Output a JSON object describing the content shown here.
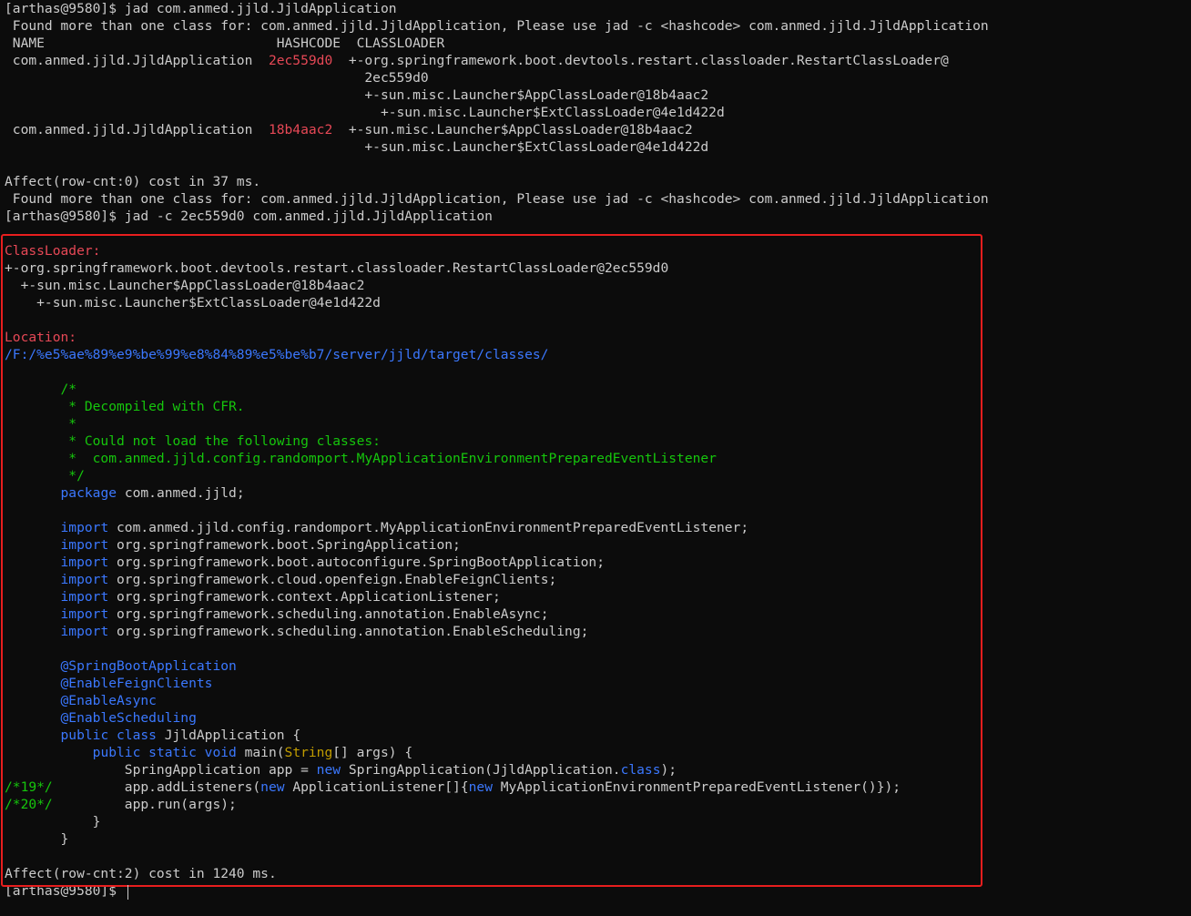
{
  "terminal": {
    "lines": [
      {
        "text": "[arthas@9580]$ jad com.anmed.jjld.JjldApplication",
        "spans": [
          {
            "t": "[arthas@9580]$ jad com.anmed.jjld.JjldApplication",
            "c": "white"
          }
        ]
      },
      {
        "text": " Found more than one class for: com.anmed.jjld.JjldApplication, Please use jad -c <hashcode> com.anmed.jjld.JjldApplication",
        "spans": [
          {
            "t": " Found more than one class for: com.anmed.jjld.JjldApplication, Please use jad -c <hashcode> com.anmed.jjld.JjldApplication",
            "c": "white"
          }
        ]
      },
      {
        "text": " NAME                             HASHCODE  CLASSLOADER",
        "spans": [
          {
            "t": " NAME                             HASHCODE  CLASSLOADER",
            "c": "white"
          }
        ]
      },
      {
        "text": " com.anmed.jjld.JjldApplication  2ec559d0  +-org.springframework.boot.devtools.restart.classloader.RestartClassLoader@",
        "spans": [
          {
            "t": " com.anmed.jjld.JjldApplication  ",
            "c": "white"
          },
          {
            "t": "2ec559d0",
            "c": "red"
          },
          {
            "t": "  +-org.springframework.boot.devtools.restart.classloader.RestartClassLoader@",
            "c": "white"
          }
        ]
      },
      {
        "text": "                                             2ec559d0",
        "spans": [
          {
            "t": "                                             2ec559d0",
            "c": "white"
          }
        ]
      },
      {
        "text": "                                             +-sun.misc.Launcher$AppClassLoader@18b4aac2",
        "spans": [
          {
            "t": "                                             +-sun.misc.Launcher$AppClassLoader@18b4aac2",
            "c": "white"
          }
        ]
      },
      {
        "text": "                                               +-sun.misc.Launcher$ExtClassLoader@4e1d422d",
        "spans": [
          {
            "t": "                                               +-sun.misc.Launcher$ExtClassLoader@4e1d422d",
            "c": "white"
          }
        ]
      },
      {
        "text": " com.anmed.jjld.JjldApplication  18b4aac2  +-sun.misc.Launcher$AppClassLoader@18b4aac2",
        "spans": [
          {
            "t": " com.anmed.jjld.JjldApplication  ",
            "c": "white"
          },
          {
            "t": "18b4aac2",
            "c": "red"
          },
          {
            "t": "  +-sun.misc.Launcher$AppClassLoader@18b4aac2",
            "c": "white"
          }
        ]
      },
      {
        "text": "                                             +-sun.misc.Launcher$ExtClassLoader@4e1d422d",
        "spans": [
          {
            "t": "                                             +-sun.misc.Launcher$ExtClassLoader@4e1d422d",
            "c": "white"
          }
        ]
      },
      {
        "text": "",
        "spans": []
      },
      {
        "text": "Affect(row-cnt:0) cost in 37 ms.",
        "spans": [
          {
            "t": "Affect(row-cnt:0) cost in 37 ms.",
            "c": "white"
          }
        ]
      },
      {
        "text": " Found more than one class for: com.anmed.jjld.JjldApplication, Please use jad -c <hashcode> com.anmed.jjld.JjldApplication",
        "spans": [
          {
            "t": " Found more than one class for: com.anmed.jjld.JjldApplication, Please use jad -c <hashcode> com.anmed.jjld.JjldApplication",
            "c": "white"
          }
        ]
      },
      {
        "text": "[arthas@9580]$ jad -c 2ec559d0 com.anmed.jjld.JjldApplication",
        "spans": [
          {
            "t": "[arthas@9580]$ jad -c 2ec559d0 com.anmed.jjld.JjldApplication",
            "c": "white"
          }
        ]
      },
      {
        "text": "",
        "spans": []
      },
      {
        "text": "ClassLoader:",
        "spans": [
          {
            "t": "ClassLoader:",
            "c": "red"
          }
        ]
      },
      {
        "text": "+-org.springframework.boot.devtools.restart.classloader.RestartClassLoader@2ec559d0",
        "spans": [
          {
            "t": "+-org.springframework.boot.devtools.restart.classloader.RestartClassLoader@2ec559d0",
            "c": "white"
          }
        ]
      },
      {
        "text": "  +-sun.misc.Launcher$AppClassLoader@18b4aac2",
        "spans": [
          {
            "t": "  +-sun.misc.Launcher$AppClassLoader@18b4aac2",
            "c": "white"
          }
        ]
      },
      {
        "text": "    +-sun.misc.Launcher$ExtClassLoader@4e1d422d",
        "spans": [
          {
            "t": "    +-sun.misc.Launcher$ExtClassLoader@4e1d422d",
            "c": "white"
          }
        ]
      },
      {
        "text": "",
        "spans": []
      },
      {
        "text": "Location:",
        "spans": [
          {
            "t": "Location:",
            "c": "red"
          }
        ]
      },
      {
        "text": "/F:/%e5%ae%89%e9%be%99%e8%84%89%e5%be%b7/server/jjld/target/classes/",
        "spans": [
          {
            "t": "/F:/%e5%ae%89%e9%be%99%e8%84%89%e5%be%b7/server/jjld/target/classes/",
            "c": "blue"
          }
        ]
      },
      {
        "text": "",
        "spans": []
      },
      {
        "text": "       /*",
        "spans": [
          {
            "t": "       /*",
            "c": "green"
          }
        ]
      },
      {
        "text": "        * Decompiled with CFR.",
        "spans": [
          {
            "t": "        * Decompiled with CFR.",
            "c": "green"
          }
        ]
      },
      {
        "text": "        *",
        "spans": [
          {
            "t": "        *",
            "c": "green"
          }
        ]
      },
      {
        "text": "        * Could not load the following classes:",
        "spans": [
          {
            "t": "        * Could not load the following classes:",
            "c": "green"
          }
        ]
      },
      {
        "text": "        *  com.anmed.jjld.config.randomport.MyApplicationEnvironmentPreparedEventListener",
        "spans": [
          {
            "t": "        *  com.anmed.jjld.config.randomport.MyApplicationEnvironmentPreparedEventListener",
            "c": "green"
          }
        ]
      },
      {
        "text": "        */",
        "spans": [
          {
            "t": "        */",
            "c": "green"
          }
        ]
      },
      {
        "text": "       package com.anmed.jjld;",
        "spans": [
          {
            "t": "       ",
            "c": "white"
          },
          {
            "t": "package",
            "c": "blue"
          },
          {
            "t": " com.anmed.jjld;",
            "c": "white"
          }
        ]
      },
      {
        "text": "",
        "spans": []
      },
      {
        "text": "       import com.anmed.jjld.config.randomport.MyApplicationEnvironmentPreparedEventListener;",
        "spans": [
          {
            "t": "       ",
            "c": "white"
          },
          {
            "t": "import",
            "c": "blue"
          },
          {
            "t": " com.anmed.jjld.config.randomport.MyApplicationEnvironmentPreparedEventListener;",
            "c": "white"
          }
        ]
      },
      {
        "text": "       import org.springframework.boot.SpringApplication;",
        "spans": [
          {
            "t": "       ",
            "c": "white"
          },
          {
            "t": "import",
            "c": "blue"
          },
          {
            "t": " org.springframework.boot.SpringApplication;",
            "c": "white"
          }
        ]
      },
      {
        "text": "       import org.springframework.boot.autoconfigure.SpringBootApplication;",
        "spans": [
          {
            "t": "       ",
            "c": "white"
          },
          {
            "t": "import",
            "c": "blue"
          },
          {
            "t": " org.springframework.boot.autoconfigure.SpringBootApplication;",
            "c": "white"
          }
        ]
      },
      {
        "text": "       import org.springframework.cloud.openfeign.EnableFeignClients;",
        "spans": [
          {
            "t": "       ",
            "c": "white"
          },
          {
            "t": "import",
            "c": "blue"
          },
          {
            "t": " org.springframework.cloud.openfeign.EnableFeignClients;",
            "c": "white"
          }
        ]
      },
      {
        "text": "       import org.springframework.context.ApplicationListener;",
        "spans": [
          {
            "t": "       ",
            "c": "white"
          },
          {
            "t": "import",
            "c": "blue"
          },
          {
            "t": " org.springframework.context.ApplicationListener;",
            "c": "white"
          }
        ]
      },
      {
        "text": "       import org.springframework.scheduling.annotation.EnableAsync;",
        "spans": [
          {
            "t": "       ",
            "c": "white"
          },
          {
            "t": "import",
            "c": "blue"
          },
          {
            "t": " org.springframework.scheduling.annotation.EnableAsync;",
            "c": "white"
          }
        ]
      },
      {
        "text": "       import org.springframework.scheduling.annotation.EnableScheduling;",
        "spans": [
          {
            "t": "       ",
            "c": "white"
          },
          {
            "t": "import",
            "c": "blue"
          },
          {
            "t": " org.springframework.scheduling.annotation.EnableScheduling;",
            "c": "white"
          }
        ]
      },
      {
        "text": "",
        "spans": []
      },
      {
        "text": "       @SpringBootApplication",
        "spans": [
          {
            "t": "       ",
            "c": "white"
          },
          {
            "t": "@SpringBootApplication",
            "c": "blue"
          }
        ]
      },
      {
        "text": "       @EnableFeignClients",
        "spans": [
          {
            "t": "       ",
            "c": "white"
          },
          {
            "t": "@EnableFeignClients",
            "c": "blue"
          }
        ]
      },
      {
        "text": "       @EnableAsync",
        "spans": [
          {
            "t": "       ",
            "c": "white"
          },
          {
            "t": "@EnableAsync",
            "c": "blue"
          }
        ]
      },
      {
        "text": "       @EnableScheduling",
        "spans": [
          {
            "t": "       ",
            "c": "white"
          },
          {
            "t": "@EnableScheduling",
            "c": "blue"
          }
        ]
      },
      {
        "text": "       public class JjldApplication {",
        "spans": [
          {
            "t": "       ",
            "c": "white"
          },
          {
            "t": "public class",
            "c": "blue"
          },
          {
            "t": " JjldApplication {",
            "c": "white"
          }
        ]
      },
      {
        "text": "           public static void main(String[] args) {",
        "spans": [
          {
            "t": "           ",
            "c": "white"
          },
          {
            "t": "public static void",
            "c": "blue"
          },
          {
            "t": " main(",
            "c": "white"
          },
          {
            "t": "String",
            "c": "yellow"
          },
          {
            "t": "[] args) {",
            "c": "white"
          }
        ]
      },
      {
        "text": "               SpringApplication app = new SpringApplication(JjldApplication.class);",
        "spans": [
          {
            "t": "               SpringApplication app = ",
            "c": "white"
          },
          {
            "t": "new",
            "c": "blue"
          },
          {
            "t": " SpringApplication(JjldApplication.",
            "c": "white"
          },
          {
            "t": "class",
            "c": "blue"
          },
          {
            "t": ");",
            "c": "white"
          }
        ]
      },
      {
        "text": "/*19*/         app.addListeners(new ApplicationListener[]{new MyApplicationEnvironmentPreparedEventListener()});",
        "spans": [
          {
            "t": "/*19*/",
            "c": "green"
          },
          {
            "t": "         app.addListeners(",
            "c": "white"
          },
          {
            "t": "new",
            "c": "blue"
          },
          {
            "t": " ApplicationListener[]{",
            "c": "white"
          },
          {
            "t": "new",
            "c": "blue"
          },
          {
            "t": " MyApplicationEnvironmentPreparedEventListener()});",
            "c": "white"
          }
        ]
      },
      {
        "text": "/*20*/         app.run(args);",
        "spans": [
          {
            "t": "/*20*/",
            "c": "green"
          },
          {
            "t": "         app.run(args);",
            "c": "white"
          }
        ]
      },
      {
        "text": "           }",
        "spans": [
          {
            "t": "           }",
            "c": "white"
          }
        ]
      },
      {
        "text": "       }",
        "spans": [
          {
            "t": "       }",
            "c": "white"
          }
        ]
      },
      {
        "text": "",
        "spans": []
      },
      {
        "text": "Affect(row-cnt:2) cost in 1240 ms.",
        "spans": [
          {
            "t": "Affect(row-cnt:2) cost in 1240 ms.",
            "c": "white"
          }
        ]
      },
      {
        "text": "[arthas@9580]$ ",
        "spans": [
          {
            "t": "[arthas@9580]$ ",
            "c": "white"
          }
        ]
      }
    ]
  },
  "colors": {
    "background": "#0c0c0c",
    "foreground": "#cccccc",
    "red": "#e74856",
    "blue": "#3b78ff",
    "green": "#16c60c",
    "yellow": "#c19c00",
    "highlight_border": "#e81e1e"
  }
}
